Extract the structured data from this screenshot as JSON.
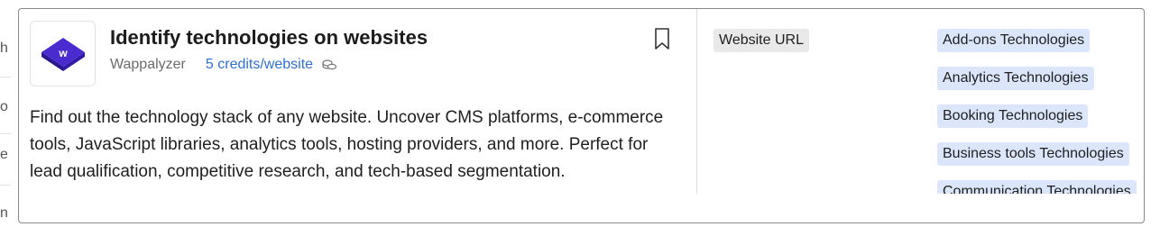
{
  "background": {
    "fragments": [
      "h",
      "o",
      "e",
      "n"
    ]
  },
  "card": {
    "title": "Identify technologies on websites",
    "vendor": "Wappalyzer",
    "credits": "5 credits/website",
    "description": "Find out the technology stack of any website. Uncover CMS platforms, e-commerce tools, JavaScript libraries, analytics tools, hosting providers, and more. Perfect for lead qualification, competitive research, and tech-based segmentation.",
    "logo_letter": "w",
    "inputs": [
      "Website URL"
    ],
    "outputs": [
      "Add-ons Technologies",
      "Analytics Technologies",
      "Booking Technologies",
      "Business tools Technologies",
      "Communication Technologies"
    ]
  },
  "colors": {
    "logo_purple": "#4a2bd0",
    "link_blue": "#2f6fd6",
    "output_tag_bg": "#dbe6fb",
    "input_tag_bg": "#e9e9e9"
  },
  "icons": {
    "bookmark": "bookmark-icon",
    "credits": "coins-icon",
    "logo": "wappalyzer-logo"
  }
}
